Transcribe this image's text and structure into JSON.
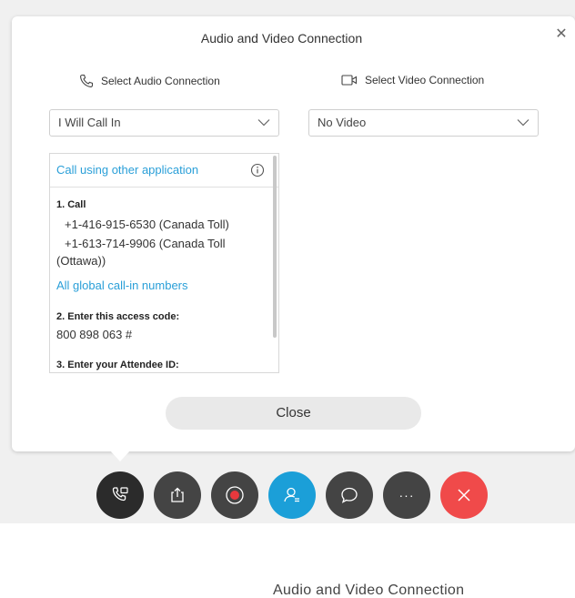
{
  "dialog": {
    "title": "Audio and Video Connection",
    "close_icon": "close-icon"
  },
  "audio": {
    "heading": "Select Audio Connection",
    "icon": "phone-icon",
    "selected": "I Will Call In"
  },
  "video": {
    "heading": "Select Video Connection",
    "icon": "video-camera-icon",
    "selected": "No Video"
  },
  "panel": {
    "link": "Call using other application",
    "info_icon": "info-icon",
    "step1": "1. Call",
    "number1": "+1-416-915-6530 (Canada Toll)",
    "number2_line1": "+1-613-714-9906 (Canada Toll",
    "number2_line2": "(Ottawa))",
    "global_link": "All global call-in numbers",
    "step2": "2. Enter this access code:",
    "access_code": "800 898 063 #",
    "step3": "3. Enter your Attendee ID:"
  },
  "close_button": "Close",
  "toolbar": {
    "buttons": [
      {
        "name": "audio-connection-icon",
        "color": "#2b2b2b"
      },
      {
        "name": "share-icon",
        "color": "#444444"
      },
      {
        "name": "record-icon",
        "color": "#444444"
      },
      {
        "name": "participants-icon",
        "color": "#1b9fd8"
      },
      {
        "name": "chat-icon",
        "color": "#444444"
      },
      {
        "name": "more-icon",
        "color": "#444444"
      },
      {
        "name": "end-meeting-icon",
        "color": "#f04a4a"
      }
    ],
    "more_label": "···"
  },
  "bottom_partial_title": "Audio and Video Connection",
  "colors": {
    "accent": "#2a9fd8",
    "end_red": "#f04a4a",
    "record_red": "#e8383d"
  }
}
